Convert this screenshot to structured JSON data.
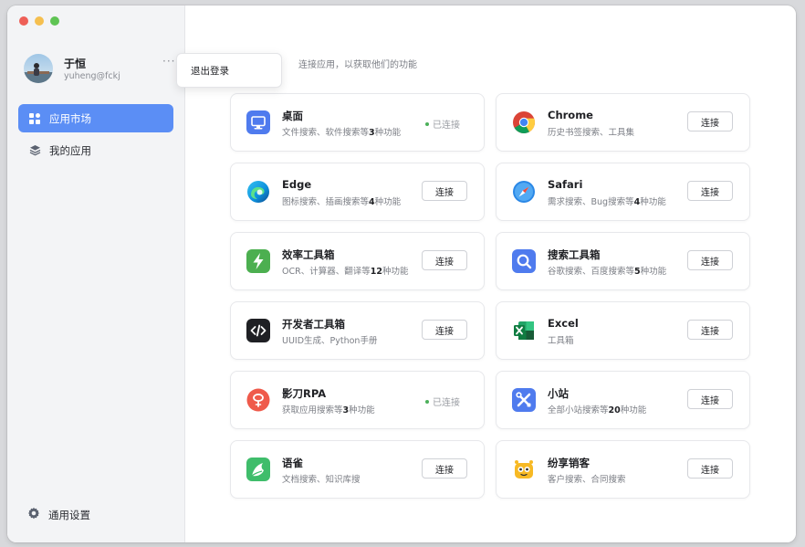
{
  "user": {
    "name": "于恒",
    "email": "yuheng@fckj",
    "more": "···"
  },
  "popup": {
    "logout_label": "退出登录"
  },
  "sidebar": {
    "items": [
      {
        "label": "应用市场",
        "icon": "grid-icon",
        "active": true
      },
      {
        "label": "我的应用",
        "icon": "layers-icon",
        "active": false
      }
    ],
    "settings_label": "通用设置",
    "settings_icon": "gear-icon"
  },
  "page": {
    "title": "场",
    "subtitle": "连接应用，以获取他们的功能"
  },
  "status": {
    "connect_label": "连接",
    "connected_label": "已连接"
  },
  "apps": [
    {
      "name": "桌面",
      "desc_pre": "文件搜索、软件搜索等",
      "desc_num": "3",
      "desc_post": "种功能",
      "connected": true,
      "icon": "desktop-icon"
    },
    {
      "name": "Chrome",
      "desc_pre": "历史书签搜索、工具集",
      "desc_num": "",
      "desc_post": "",
      "connected": false,
      "icon": "chrome-icon"
    },
    {
      "name": "Edge",
      "desc_pre": "图标搜索、插画搜索等",
      "desc_num": "4",
      "desc_post": "种功能",
      "connected": false,
      "icon": "edge-icon"
    },
    {
      "name": "Safari",
      "desc_pre": "需求搜索、Bug搜索等",
      "desc_num": "4",
      "desc_post": "种功能",
      "connected": false,
      "icon": "safari-icon"
    },
    {
      "name": "效率工具箱",
      "desc_pre": "OCR、计算器、翻译等",
      "desc_num": "12",
      "desc_post": "种功能",
      "connected": false,
      "icon": "lightning-icon"
    },
    {
      "name": "搜索工具箱",
      "desc_pre": "谷歌搜索、百度搜索等",
      "desc_num": "5",
      "desc_post": "种功能",
      "connected": false,
      "icon": "search-icon"
    },
    {
      "name": "开发者工具箱",
      "desc_pre": "UUID生成、Python手册",
      "desc_num": "",
      "desc_post": "",
      "connected": false,
      "icon": "code-icon"
    },
    {
      "name": "Excel",
      "desc_pre": "工具箱",
      "desc_num": "",
      "desc_post": "",
      "connected": false,
      "icon": "excel-icon"
    },
    {
      "name": "影刀RPA",
      "desc_pre": "获取应用搜索等",
      "desc_num": "3",
      "desc_post": "种功能",
      "connected": true,
      "icon": "rpa-icon"
    },
    {
      "name": "小站",
      "desc_pre": "全部小站搜索等",
      "desc_num": "20",
      "desc_post": "种功能",
      "connected": false,
      "icon": "tools-icon"
    },
    {
      "name": "语雀",
      "desc_pre": "文档搜索、知识库搜",
      "desc_num": "",
      "desc_post": "",
      "connected": false,
      "icon": "yuque-icon"
    },
    {
      "name": "纷享销客",
      "desc_pre": "客户搜索、合同搜索",
      "desc_num": "",
      "desc_post": "",
      "connected": false,
      "icon": "fxiaoke-icon"
    }
  ],
  "colors": {
    "accent": "#5b8ef5",
    "connected_dot": "#4cb05a"
  }
}
